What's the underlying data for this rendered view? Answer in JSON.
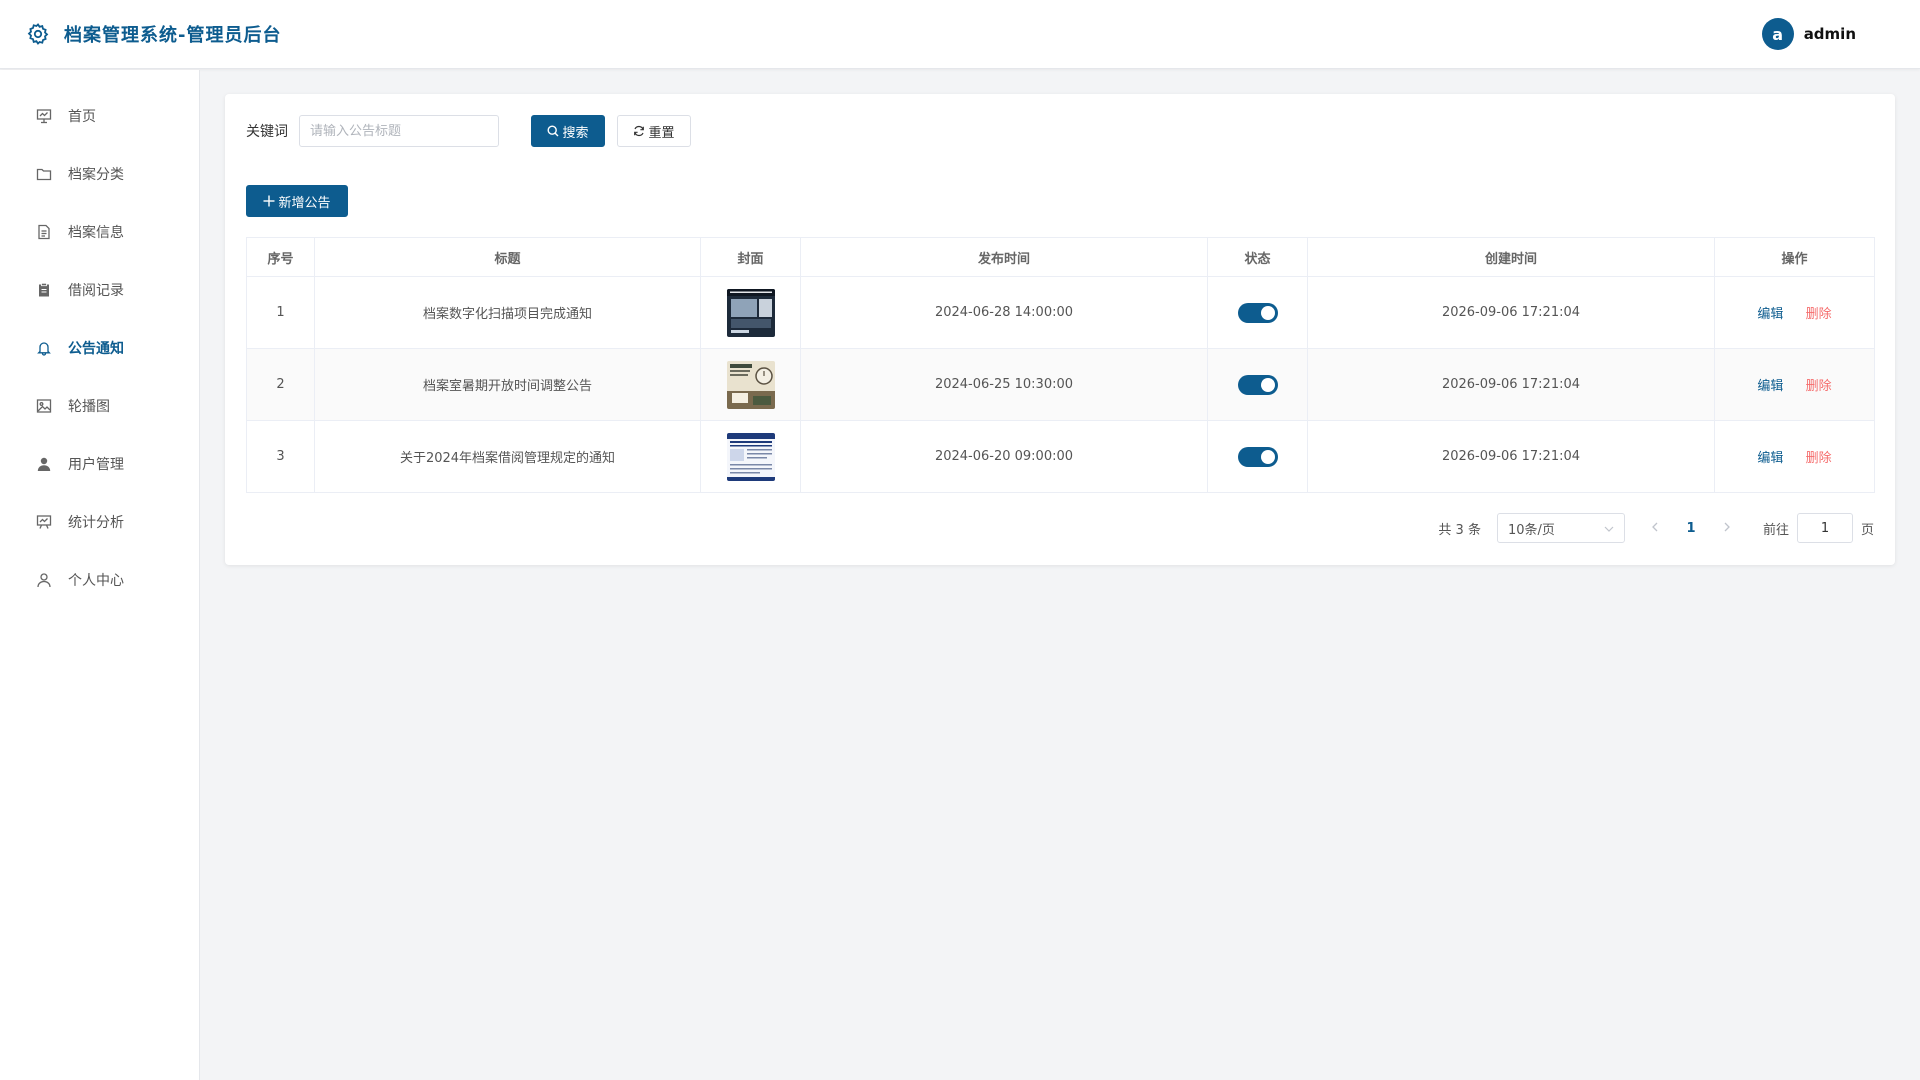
{
  "header": {
    "title": "档案管理系统-管理员后台",
    "avatar_letter": "a",
    "username": "admin",
    "accent": "#0d5c8f"
  },
  "sidebar": {
    "items": [
      {
        "label": "首页",
        "icon": "dashboard-icon"
      },
      {
        "label": "档案分类",
        "icon": "folder-icon"
      },
      {
        "label": "档案信息",
        "icon": "document-icon"
      },
      {
        "label": "借阅记录",
        "icon": "clipboard-icon"
      },
      {
        "label": "公告通知",
        "icon": "bell-icon",
        "active": true
      },
      {
        "label": "轮播图",
        "icon": "image-icon"
      },
      {
        "label": "用户管理",
        "icon": "user-filled-icon"
      },
      {
        "label": "统计分析",
        "icon": "chart-board-icon"
      },
      {
        "label": "个人中心",
        "icon": "user-icon"
      }
    ]
  },
  "search": {
    "label": "关键词",
    "placeholder": "请输入公告标题",
    "value": "",
    "search_label": "搜索",
    "reset_label": "重置"
  },
  "toolbar": {
    "add_label": "新增公告"
  },
  "table": {
    "headers": [
      "序号",
      "标题",
      "封面",
      "发布时间",
      "状态",
      "创建时间",
      "操作"
    ],
    "rows": [
      {
        "index": "1",
        "title": "档案数字化扫描项目完成通知",
        "publish_time": "2024-06-28 14:00:00",
        "status_on": true,
        "created_time": "2026-09-06 17:21:04",
        "edit": "编辑",
        "delete": "删除"
      },
      {
        "index": "2",
        "title": "档案室暑期开放时间调整公告",
        "publish_time": "2024-06-25 10:30:00",
        "status_on": true,
        "created_time": "2026-09-06 17:21:04",
        "edit": "编辑",
        "delete": "删除"
      },
      {
        "index": "3",
        "title": "关于2024年档案借阅管理规定的通知",
        "publish_time": "2024-06-20 09:00:00",
        "status_on": true,
        "created_time": "2026-09-06 17:21:04",
        "edit": "编辑",
        "delete": "删除"
      }
    ]
  },
  "pagination": {
    "total_text": "共 3 条",
    "page_size": "10条/页",
    "current_page": "1",
    "goto_label": "前往",
    "goto_value": "1",
    "page_unit": "页"
  }
}
